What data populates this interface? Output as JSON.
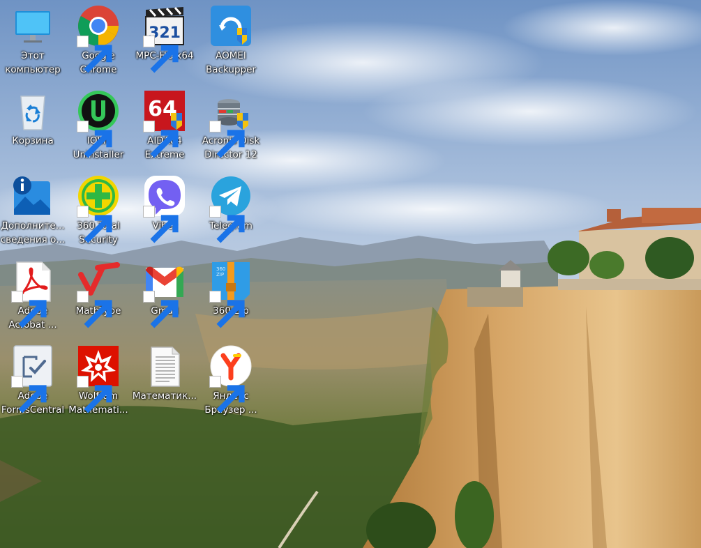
{
  "desktop": {
    "icons": [
      {
        "id": "this-pc",
        "line1": "Этот",
        "line2": "компьютер",
        "icon": "monitor-icon",
        "shortcut": false
      },
      {
        "id": "chrome",
        "line1": "Google",
        "line2": "Chrome",
        "icon": "chrome-icon",
        "shortcut": true
      },
      {
        "id": "mpc",
        "line1": "MPC-HC x64",
        "line2": "",
        "icon": "mpc-clapperboard-icon",
        "shortcut": true
      },
      {
        "id": "aomei",
        "line1": "AOMEI",
        "line2": "Backupper",
        "icon": "aomei-icon",
        "shortcut": false
      },
      {
        "id": "recycle",
        "line1": "Корзина",
        "line2": "",
        "icon": "recycle-bin-icon",
        "shortcut": false
      },
      {
        "id": "iobit",
        "line1": "IObit",
        "line2": "Uninstaller",
        "icon": "iobit-icon",
        "shortcut": true
      },
      {
        "id": "aida",
        "line1": "AIDA64",
        "line2": "Extreme",
        "icon": "aida64-icon",
        "shortcut": true
      },
      {
        "id": "acronis",
        "line1": "Acronis Disk",
        "line2": "Director 12",
        "icon": "acronis-icon",
        "shortcut": true
      },
      {
        "id": "extra",
        "line1": "Дополните...",
        "line2": "сведения о...",
        "icon": "info-photo-icon",
        "shortcut": false
      },
      {
        "id": "360ts",
        "line1": "360 Total",
        "line2": "Security",
        "icon": "360-security-icon",
        "shortcut": true
      },
      {
        "id": "viber",
        "line1": "Viber",
        "line2": "",
        "icon": "viber-icon",
        "shortcut": true
      },
      {
        "id": "telegram",
        "line1": "Telegram",
        "line2": "",
        "icon": "telegram-icon",
        "shortcut": true
      },
      {
        "id": "acrobat",
        "line1": "Adobe",
        "line2": "Acrobat ...",
        "icon": "acrobat-icon",
        "shortcut": true
      },
      {
        "id": "mathtype",
        "line1": "MathType",
        "line2": "",
        "icon": "mathtype-icon",
        "shortcut": true
      },
      {
        "id": "gmail",
        "line1": "Gmail",
        "line2": "",
        "icon": "gmail-icon",
        "shortcut": true
      },
      {
        "id": "zip360",
        "line1": "360 Zip",
        "line2": "",
        "icon": "360-zip-icon",
        "shortcut": true
      },
      {
        "id": "forms",
        "line1": "Adobe",
        "line2": "FormsCentral",
        "icon": "forms-central-icon",
        "shortcut": true
      },
      {
        "id": "wolfram",
        "line1": "Wolfram",
        "line2": "Mathemati...",
        "icon": "wolfram-icon",
        "shortcut": true
      },
      {
        "id": "mathdoc",
        "line1": "Математик...",
        "line2": "",
        "icon": "text-document-icon",
        "shortcut": false
      },
      {
        "id": "yandex",
        "line1": "Яндекс",
        "line2": "Браузер ...",
        "icon": "yandex-browser-icon",
        "shortcut": true
      }
    ]
  }
}
